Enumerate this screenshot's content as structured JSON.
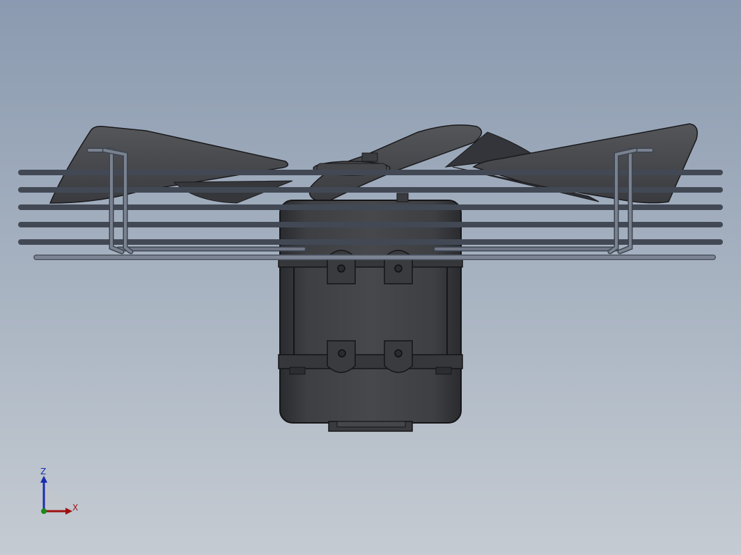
{
  "window": {
    "title": ""
  },
  "viewport": {
    "background_top": "#8b9ab0",
    "background_bottom": "#c5cbd2",
    "model_color": "#3a3b3f",
    "model_edge": "#1a1a1c",
    "guard_color": "#6b7483"
  },
  "triad": {
    "z_label": "Z",
    "x_label": "X",
    "z_color": "#1a2bb0",
    "x_color": "#a01010",
    "y_color": "#1a8a1a"
  }
}
